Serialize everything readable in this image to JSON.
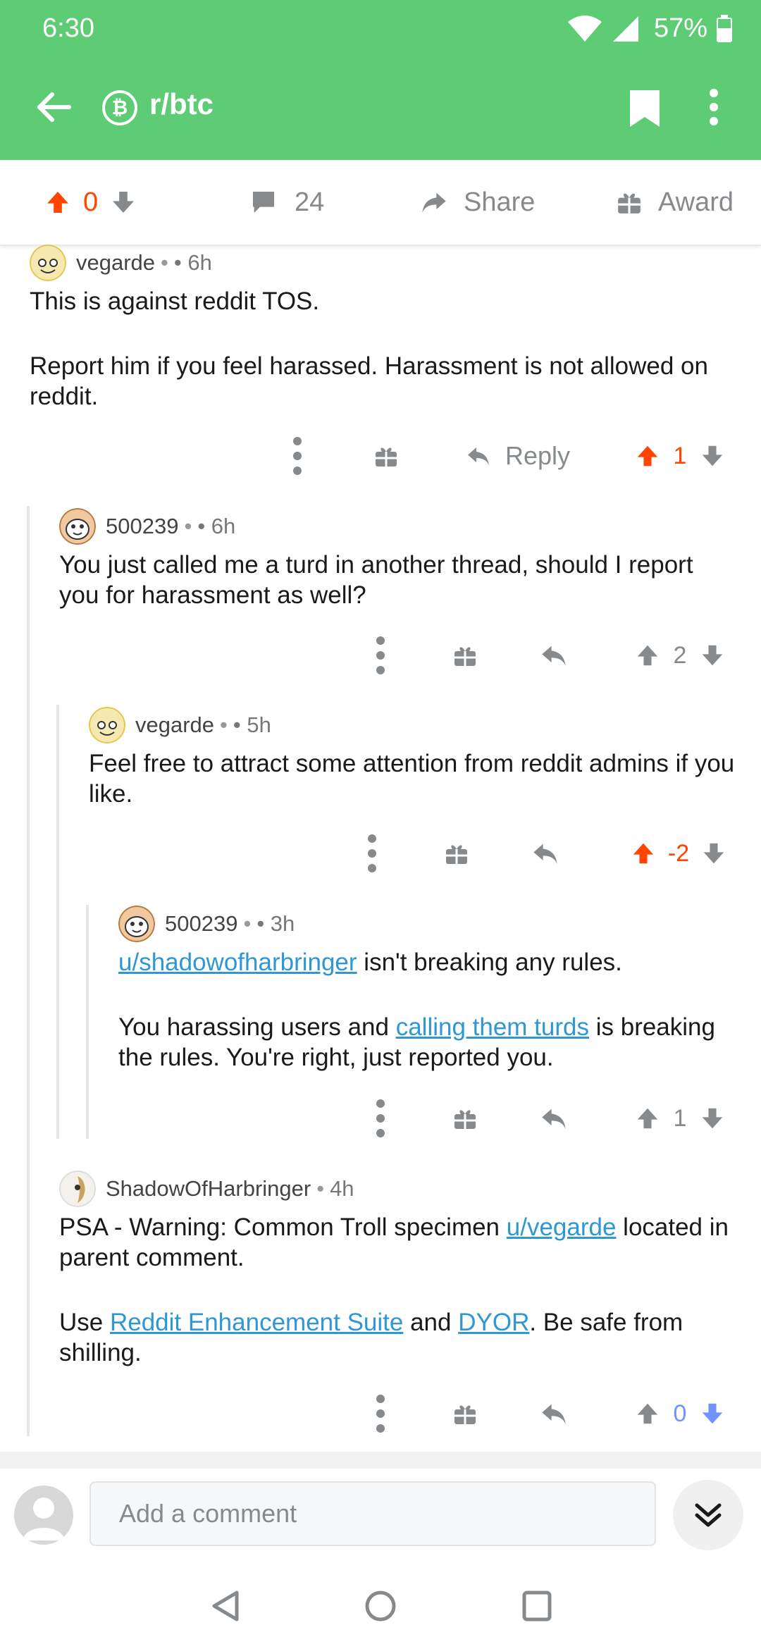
{
  "status": {
    "time": "6:30",
    "battery": "57%"
  },
  "header": {
    "subreddit": "r/btc",
    "sub_icon": "bitcoin-icon"
  },
  "actions": {
    "score": "0",
    "comments": "24",
    "share": "Share",
    "award": "Award"
  },
  "comments": [
    {
      "author": "vegarde",
      "age": "6h",
      "paragraphs": [
        "This is against reddit TOS.",
        "Report him if you feel harassed. Harassment is not allowed on reddit."
      ],
      "reply_label": "Reply",
      "score": "1",
      "vote": "up"
    },
    {
      "author": "500239",
      "age": "6h",
      "paragraphs": [
        "You just called me a turd in another thread, should I report you for harassment as well?"
      ],
      "score": "2",
      "vote": "none"
    },
    {
      "author": "vegarde",
      "age": "5h",
      "paragraphs": [
        "Feel free to attract some attention from reddit admins if you like."
      ],
      "score": "-2",
      "vote": "up"
    },
    {
      "author": "500239",
      "age": "3h",
      "link1": "u/shadowofharbringer",
      "text1": " isn't breaking any rules.",
      "text2a": "You harassing users and ",
      "link2": "calling them turds",
      "text2b": " is breaking the rules. You're right, just reported you.",
      "score": "1",
      "vote": "none"
    },
    {
      "author": "ShadowOfHarbringer",
      "age": "4h",
      "text1a": "PSA - Warning: Common Troll specimen ",
      "link1": "u/vegarde",
      "text1b": " located in parent comment.",
      "text2a": "Use ",
      "link2": "Reddit Enhancement Suite",
      "text2b": " and ",
      "link3": "DYOR",
      "text2c": ". Be safe from shilling.",
      "score": "0",
      "vote": "down"
    }
  ],
  "composer": {
    "placeholder": "Add a comment"
  },
  "colors": {
    "header": "#5ecb75",
    "upvote": "#ff4500",
    "downvote": "#7193ff",
    "link": "#2e97d4",
    "neutral": "#878a8c"
  }
}
